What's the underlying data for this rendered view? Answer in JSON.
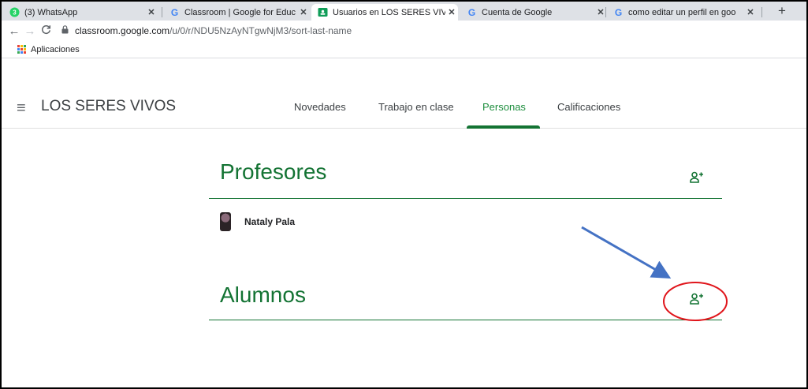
{
  "browser": {
    "tabs": [
      {
        "title": "(3) WhatsApp",
        "favicon": "whatsapp-icon",
        "badge": "3"
      },
      {
        "title": "Classroom | Google for Educ",
        "favicon": "google-icon"
      },
      {
        "title": "Usuarios en LOS SERES VIVO",
        "favicon": "classroom-icon",
        "active": true
      },
      {
        "title": "Cuenta de Google",
        "favicon": "google-icon"
      },
      {
        "title": "como editar un perfil en goo",
        "favicon": "google-icon"
      }
    ],
    "url_host": "classroom.google.com",
    "url_path": "/u/0/r/NDU5NzAyNTgwNjM3/sort-last-name",
    "bookmarks": [
      {
        "label": "Aplicaciones",
        "icon": "apps-grid-icon"
      }
    ]
  },
  "classroom": {
    "class_name": "LOS SERES VIVOS",
    "tabs": [
      {
        "label": "Novedades"
      },
      {
        "label": "Trabajo en clase"
      },
      {
        "label": "Personas",
        "active": true
      },
      {
        "label": "Calificaciones"
      }
    ],
    "teachers": {
      "title": "Profesores",
      "people": [
        {
          "name": "Nataly Pala"
        }
      ]
    },
    "students": {
      "title": "Alumnos",
      "people": []
    }
  },
  "colors": {
    "accent_green": "#137333",
    "annotation_arrow": "#4472c4",
    "annotation_circle": "#e0151b"
  }
}
